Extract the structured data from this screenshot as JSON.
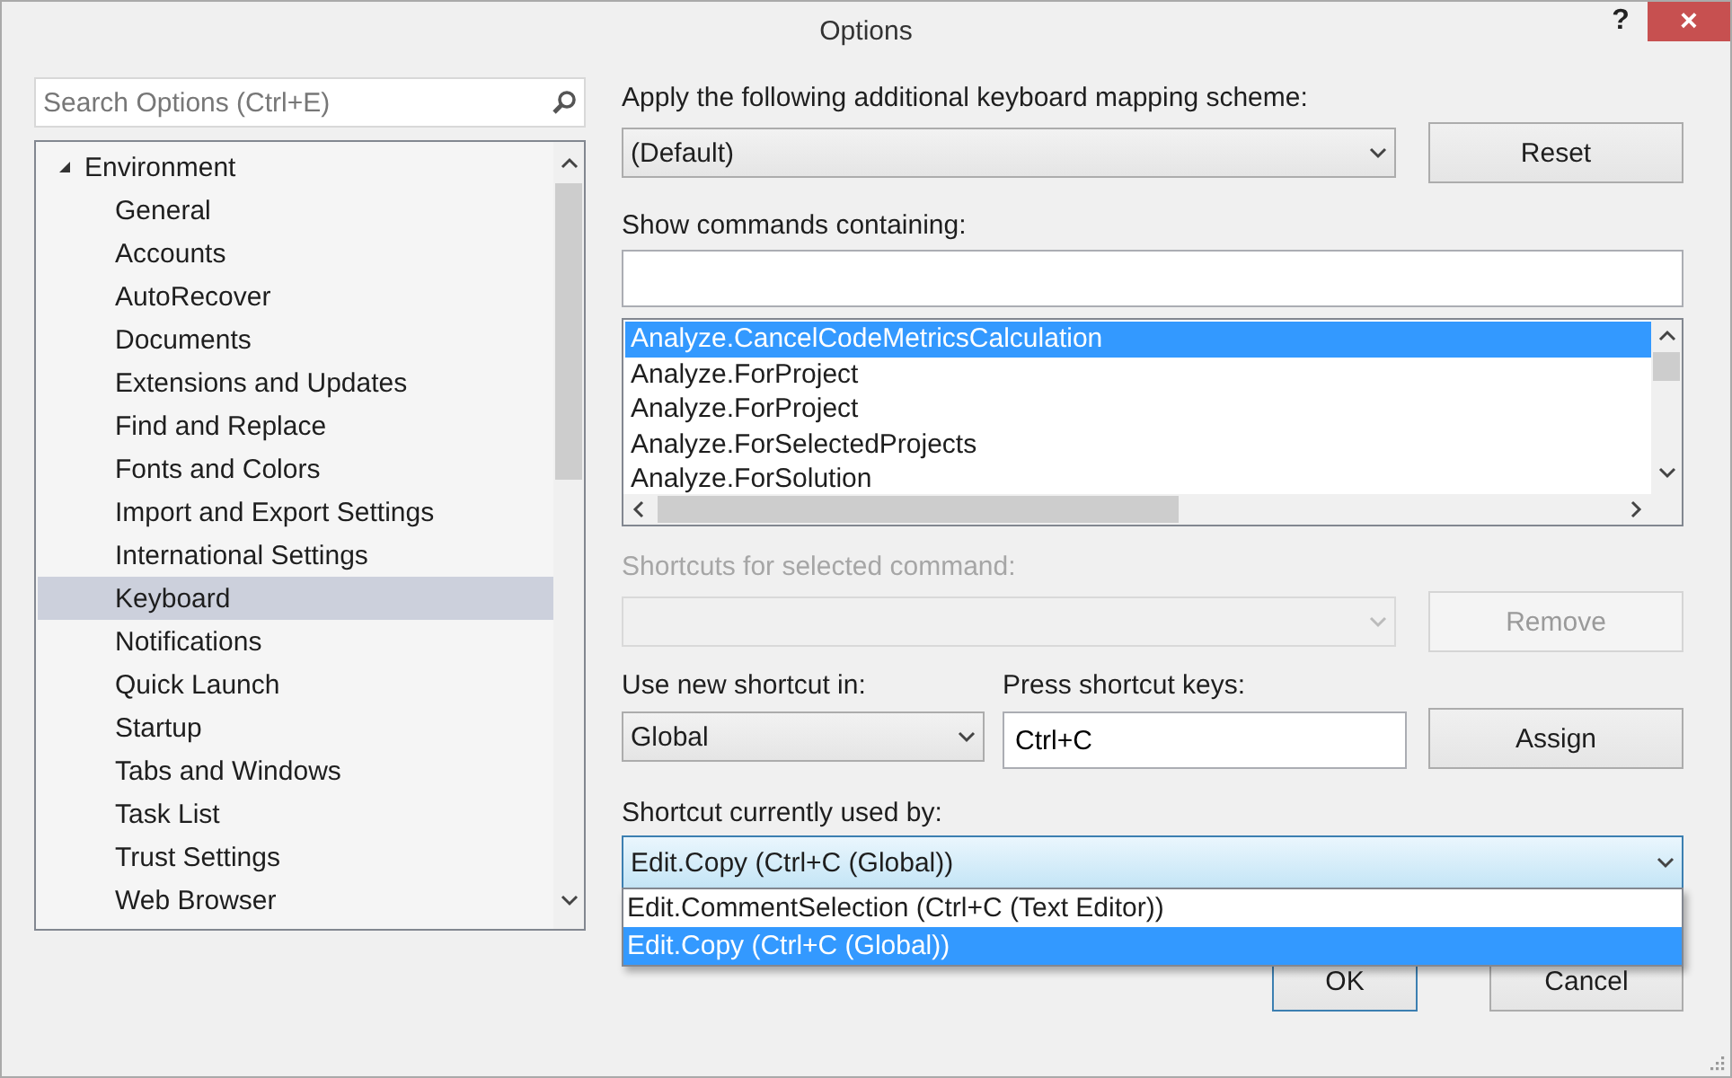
{
  "window": {
    "title": "Options",
    "help": "?",
    "close": "×"
  },
  "search": {
    "placeholder": "Search Options (Ctrl+E)"
  },
  "tree": [
    {
      "label": "Environment",
      "expanded": true,
      "selected": false,
      "children": [
        {
          "label": "General",
          "selected": false
        },
        {
          "label": "Accounts",
          "selected": false
        },
        {
          "label": "AutoRecover",
          "selected": false
        },
        {
          "label": "Documents",
          "selected": false
        },
        {
          "label": "Extensions and Updates",
          "selected": false
        },
        {
          "label": "Find and Replace",
          "selected": false
        },
        {
          "label": "Fonts and Colors",
          "selected": false
        },
        {
          "label": "Import and Export Settings",
          "selected": false
        },
        {
          "label": "International Settings",
          "selected": false
        },
        {
          "label": "Keyboard",
          "selected": true
        },
        {
          "label": "Notifications",
          "selected": false
        },
        {
          "label": "Quick Launch",
          "selected": false
        },
        {
          "label": "Startup",
          "selected": false
        },
        {
          "label": "Tabs and Windows",
          "selected": false
        },
        {
          "label": "Task List",
          "selected": false
        },
        {
          "label": "Trust Settings",
          "selected": false
        },
        {
          "label": "Web Browser",
          "selected": false
        }
      ]
    }
  ],
  "mapping_scheme": {
    "label": "Apply the following additional keyboard mapping scheme:",
    "value": "(Default)"
  },
  "reset_button": {
    "label": "Reset",
    "disabled": false
  },
  "show_commands": {
    "label": "Show commands containing:"
  },
  "commands": [
    {
      "label": "Analyze.CancelCodeMetricsCalculation",
      "selected": true
    },
    {
      "label": "Analyze.ForProject",
      "selected": false
    },
    {
      "label": "Analyze.ForProject",
      "selected": false
    },
    {
      "label": "Analyze.ForSelectedProjects",
      "selected": false
    },
    {
      "label": "Analyze.ForSolution",
      "selected": false
    }
  ],
  "shortcuts_for_selected": {
    "label": "Shortcuts for selected command:",
    "disabled": true
  },
  "remove_button": {
    "label": "Remove",
    "disabled": true
  },
  "use_new_shortcut_in": {
    "label": "Use new shortcut in:",
    "value": "Global"
  },
  "press_shortcut_keys": {
    "label": "Press shortcut keys:",
    "value": "Ctrl+C"
  },
  "assign_button": {
    "label": "Assign",
    "disabled": false
  },
  "currently_used_by": {
    "label": "Shortcut currently used by:",
    "value": "Edit.Copy (Ctrl+C (Global))",
    "expanded": true,
    "options": [
      {
        "label": "Edit.CommentSelection (Ctrl+C (Text Editor))",
        "selected": false
      },
      {
        "label": "Edit.Copy (Ctrl+C (Global))",
        "selected": true
      }
    ]
  },
  "buttons": [
    {
      "label": "OK",
      "default": true
    },
    {
      "label": "Cancel",
      "default": false
    }
  ]
}
